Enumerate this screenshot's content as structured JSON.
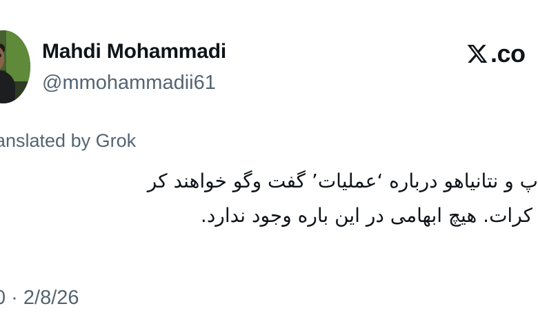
{
  "tweet": {
    "author": {
      "name": "Mahdi Mohammadi",
      "handle": "@mmohammadii61"
    },
    "site_logo_text": ".co",
    "translated_label": "ranslated by Grok",
    "text_lines": [
      "پ و نتانیاهو درباره ‘عملیات’ گفت وگو خواهند کر",
      "کرات. هیچ ابهامی در این باره وجود ندارد."
    ],
    "timestamp": "0 · 2/8/26"
  },
  "icons": {
    "avatar": "user-avatar-photo",
    "logo": "x-logo-icon"
  },
  "colors": {
    "text": "#0f1419",
    "secondary": "#536471",
    "background": "#ffffff"
  }
}
